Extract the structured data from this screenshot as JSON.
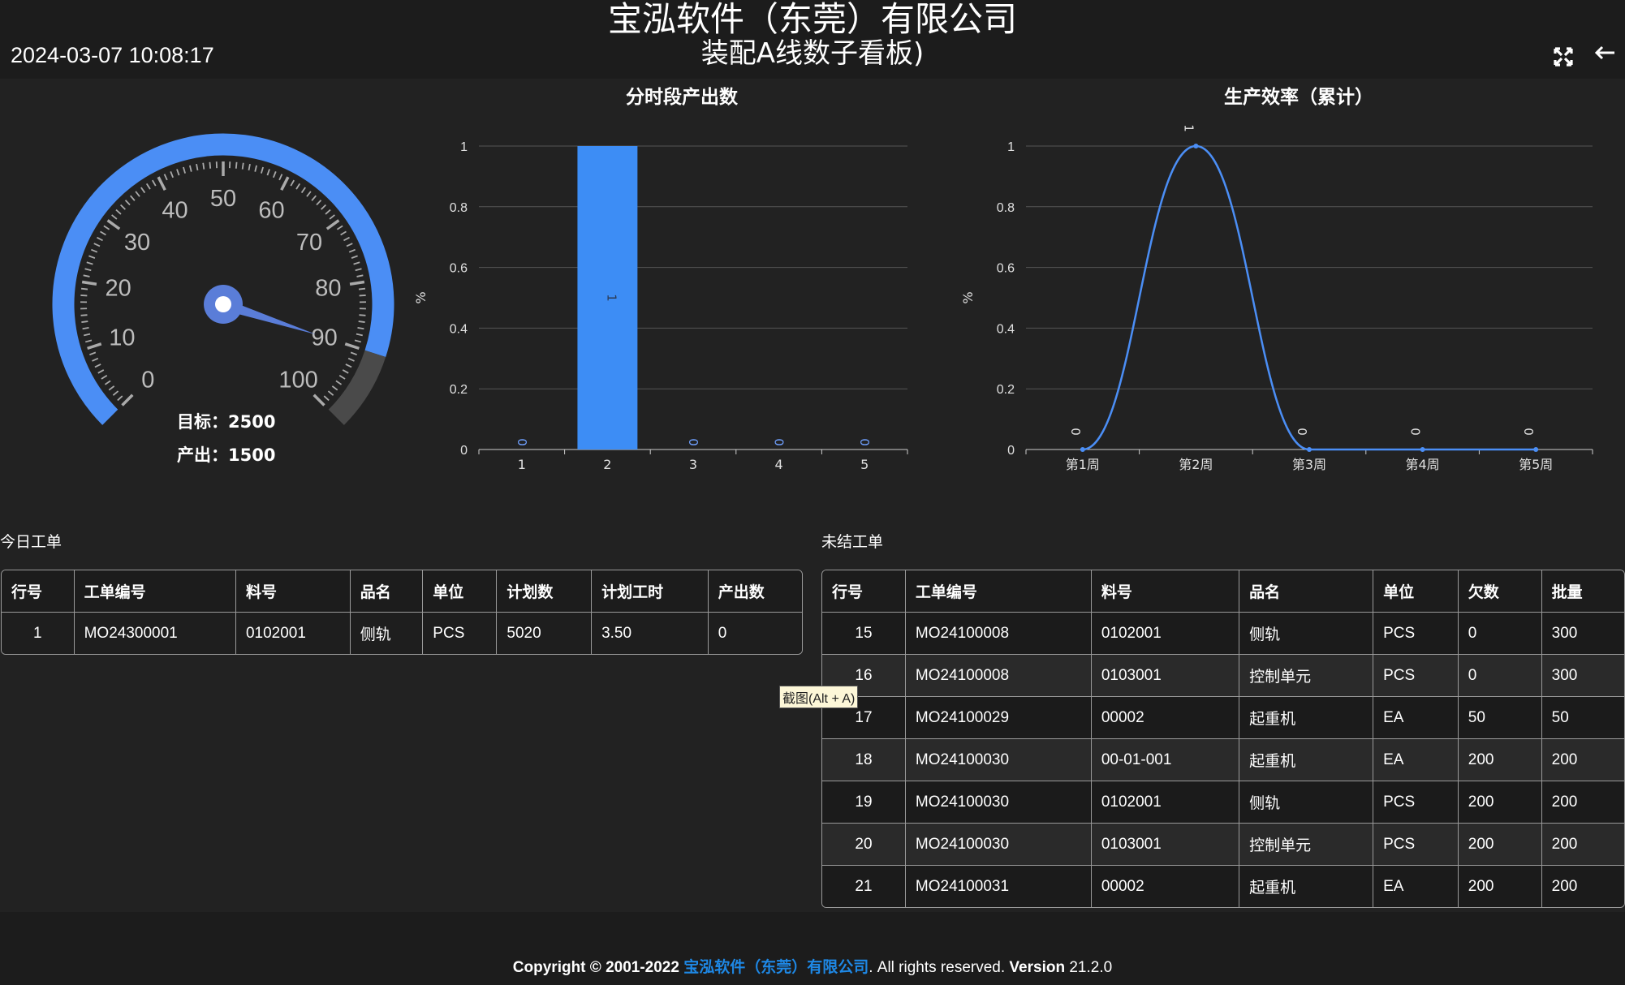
{
  "header": {
    "company": "宝泓软件（东莞）有限公司",
    "board": "装配A线数子看板)",
    "datetime": "2024-03-07 10:08:17",
    "fullscreen_icon": "fullscreen-icon",
    "back_icon": "back-arrow-icon"
  },
  "gauge": {
    "min": 0,
    "max": 100,
    "value": 90,
    "ticks": [
      "0",
      "10",
      "20",
      "30",
      "40",
      "50",
      "60",
      "70",
      "80",
      "90",
      "100"
    ],
    "target_label": "目标：2500",
    "output_label": "产出：1500",
    "colors": {
      "progress": "#4b8ef5",
      "rest": "#4a4a4a",
      "pointer": "#5a7dd8"
    }
  },
  "chart_data": [
    {
      "type": "bar",
      "title": "分时段产出数",
      "ylabel": "%",
      "categories": [
        "1",
        "2",
        "3",
        "4",
        "5"
      ],
      "values": [
        0,
        1,
        0,
        0,
        0
      ],
      "data_labels": [
        "0",
        "1",
        "0",
        "0",
        "0"
      ],
      "ylim": [
        0,
        1
      ],
      "yticks": [
        "0",
        "0.2",
        "0.4",
        "0.6",
        "0.8",
        "1"
      ],
      "grid": true,
      "color": "#3d8df5"
    },
    {
      "type": "line",
      "title": "生产效率（累计）",
      "ylabel": "%",
      "categories": [
        "第1周",
        "第2周",
        "第3周",
        "第4周",
        "第5周"
      ],
      "values": [
        0,
        1,
        0,
        0,
        0
      ],
      "data_labels": [
        "0",
        "1",
        "0",
        "0",
        "0"
      ],
      "ylim": [
        0,
        1
      ],
      "yticks": [
        "0",
        "0.2",
        "0.4",
        "0.6",
        "0.8",
        "1"
      ],
      "grid": true,
      "smooth": true,
      "color": "#4b8ef5"
    }
  ],
  "today": {
    "title": "今日工单",
    "columns": [
      "行号",
      "工单编号",
      "料号",
      "品名",
      "单位",
      "计划数",
      "计划工时",
      "产出数"
    ],
    "rows": [
      [
        "1",
        "MO24300001",
        "0102001",
        "侧轨",
        "PCS",
        "5020",
        "3.50",
        "0"
      ]
    ]
  },
  "open": {
    "title": "未结工单",
    "columns": [
      "行号",
      "工单编号",
      "料号",
      "品名",
      "单位",
      "欠数",
      "批量"
    ],
    "rows": [
      [
        "15",
        "MO24100008",
        "0102001",
        "侧轨",
        "PCS",
        "0",
        "300"
      ],
      [
        "16",
        "MO24100008",
        "0103001",
        "控制单元",
        "PCS",
        "0",
        "300"
      ],
      [
        "17",
        "MO24100029",
        "00002",
        "起重机",
        "EA",
        "50",
        "50"
      ],
      [
        "18",
        "MO24100030",
        "00-01-001",
        "起重机",
        "EA",
        "200",
        "200"
      ],
      [
        "19",
        "MO24100030",
        "0102001",
        "侧轨",
        "PCS",
        "200",
        "200"
      ],
      [
        "20",
        "MO24100030",
        "0103001",
        "控制单元",
        "PCS",
        "200",
        "200"
      ],
      [
        "21",
        "MO24100031",
        "00002",
        "起重机",
        "EA",
        "200",
        "200"
      ]
    ]
  },
  "tooltip": "截图(Alt + A)",
  "footer": {
    "prefix": "Copyright © 2001-2022",
    "company": "宝泓软件（东莞）有限公司",
    "middle": ". All rights reserved.",
    "version_label": "Version",
    "version": "21.2.0"
  }
}
